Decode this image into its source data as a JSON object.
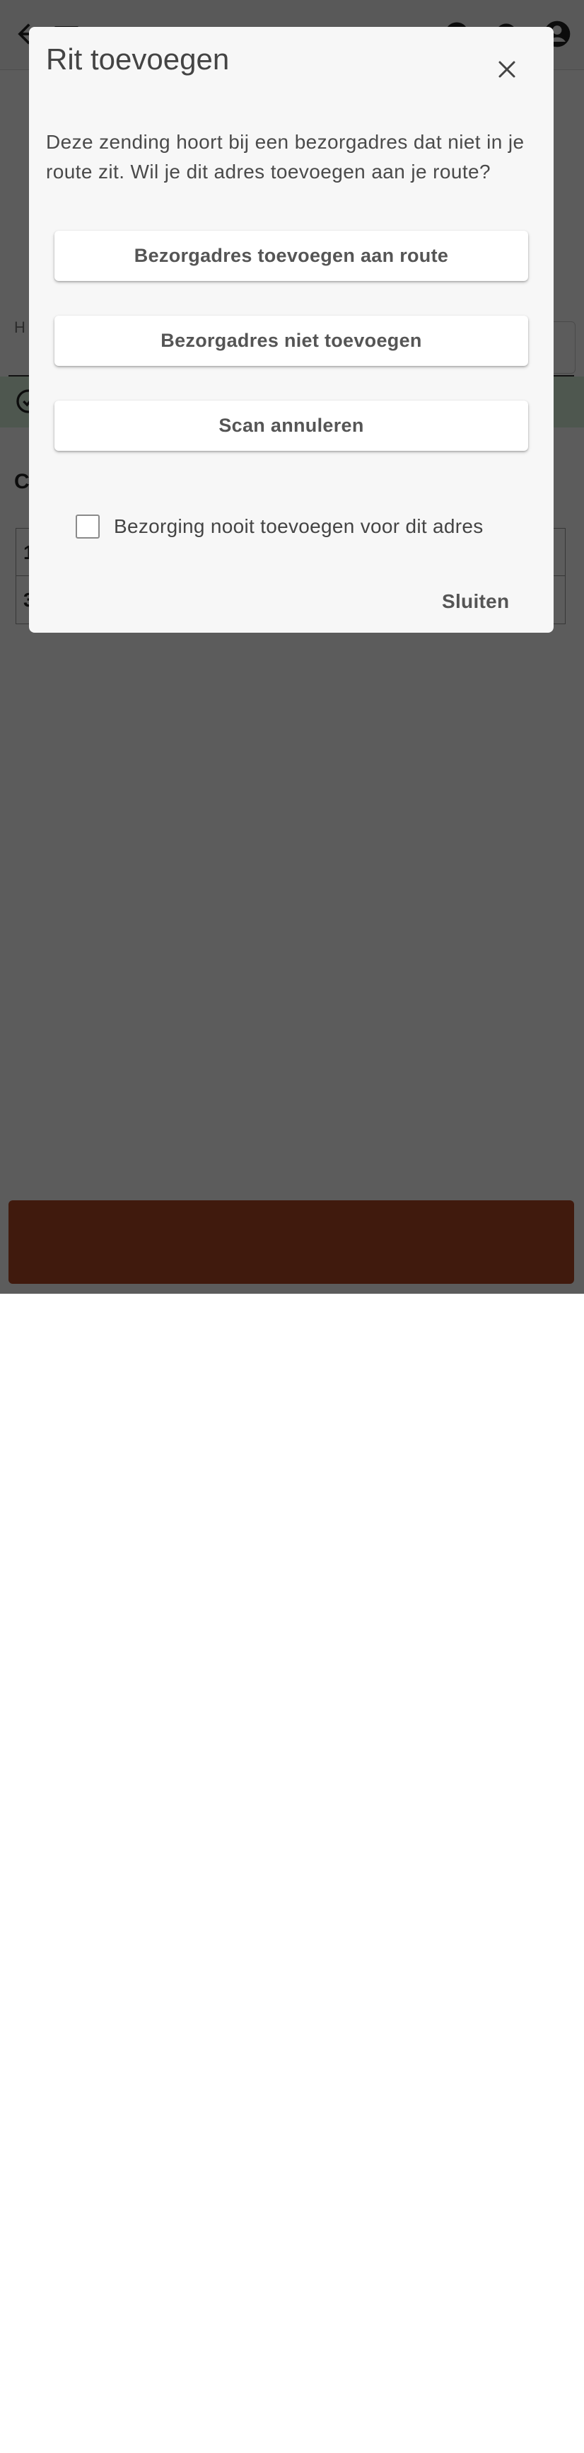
{
  "dialog": {
    "title": "Rit toevoegen",
    "message": "Deze zending hoort bij een bezorgadres dat niet in je route zit. Wil je dit adres toevoegen aan je route?",
    "buttons": [
      {
        "label": "Bezorgadres toevoegen aan route"
      },
      {
        "label": "Bezorgadres niet toevoegen"
      },
      {
        "label": "Scan annuleren"
      }
    ],
    "checkbox": {
      "label": "Bezorging nooit toevoegen voor dit adres",
      "checked": false
    },
    "close_label": "Sluiten",
    "close_icon": "close-icon"
  },
  "background": {
    "tab_label": "H",
    "heading": "C",
    "table_rows": [
      {
        "text": "1"
      },
      {
        "text": "3"
      }
    ],
    "bottom_button_icon": "check-icon"
  },
  "colors": {
    "dialog_bg": "#f7f7f7",
    "bottom_button": "#b24a25",
    "success_bar": "#d9f0db",
    "overlay": "rgba(0,0,0,0.64)"
  }
}
